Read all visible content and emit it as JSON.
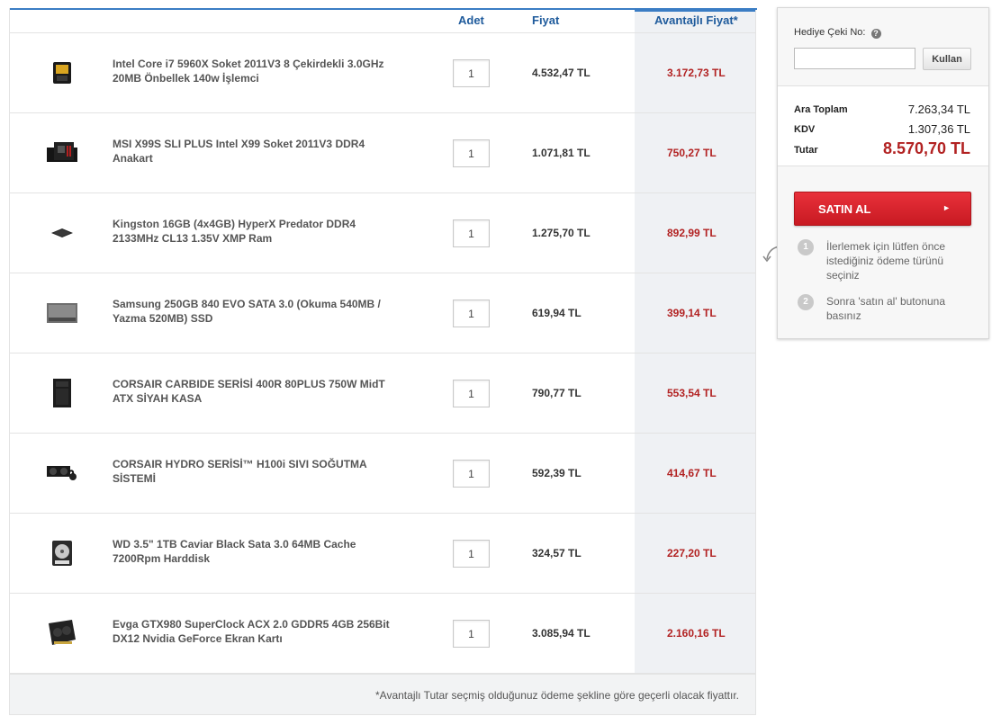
{
  "cart": {
    "headers": {
      "qty": "Adet",
      "price": "Fiyat",
      "advantage": "Avantajlı Fiyat*"
    },
    "items": [
      {
        "name": "Intel Core i7 5960X Soket 2011V3 8 Çekirdekli 3.0GHz 20MB Önbellek 140w İşlemci",
        "qty": "1",
        "price": "4.532,47 TL",
        "adv_price": "3.172,73 TL",
        "icon": "cpu-icon"
      },
      {
        "name": "MSI X99S SLI PLUS Intel X99 Soket 2011V3 DDR4 Anakart",
        "qty": "1",
        "price": "1.071,81 TL",
        "adv_price": "750,27 TL",
        "icon": "motherboard-icon"
      },
      {
        "name": "Kingston 16GB (4x4GB) HyperX Predator DDR4 2133MHz CL13 1.35V XMP Ram",
        "qty": "1",
        "price": "1.275,70 TL",
        "adv_price": "892,99 TL",
        "icon": "ram-icon"
      },
      {
        "name": "Samsung 250GB 840 EVO SATA 3.0 (Okuma 540MB / Yazma 520MB) SSD",
        "qty": "1",
        "price": "619,94 TL",
        "adv_price": "399,14 TL",
        "icon": "ssd-icon"
      },
      {
        "name": "CORSAIR CARBIDE SERİSİ 400R 80PLUS 750W MidT ATX SİYAH KASA",
        "qty": "1",
        "price": "790,77 TL",
        "adv_price": "553,54 TL",
        "icon": "pc-case-icon"
      },
      {
        "name": "CORSAIR HYDRO SERİSİ™ H100i SIVI SOĞUTMA SİSTEMİ",
        "qty": "1",
        "price": "592,39 TL",
        "adv_price": "414,67 TL",
        "icon": "liquid-cooler-icon"
      },
      {
        "name": "WD 3.5\" 1TB Caviar Black Sata 3.0 64MB Cache 7200Rpm Harddisk",
        "qty": "1",
        "price": "324,57 TL",
        "adv_price": "227,20 TL",
        "icon": "hard-disk-icon"
      },
      {
        "name": "Evga GTX980 SuperClock ACX 2.0 GDDR5 4GB 256Bit DX12 Nvidia GeForce Ekran Kartı",
        "qty": "1",
        "price": "3.085,94 TL",
        "adv_price": "2.160,16 TL",
        "icon": "graphics-card-icon"
      }
    ],
    "footnote": "*Avantajlı Tutar seçmiş olduğunuz ödeme şekline göre geçerli olacak fiyattır."
  },
  "summary": {
    "gift_label": "Hediye Çeki No:",
    "gift_value": "",
    "use_label": "Kullan",
    "subtotal_label": "Ara Toplam",
    "subtotal": "7.263,34 TL",
    "tax_label": "KDV",
    "tax": "1.307,36 TL",
    "total_label": "Tutar",
    "total": "8.570,70 TL",
    "buy_label": "SATIN AL",
    "steps": [
      {
        "num": "1",
        "text": "İlerlemek için lütfen önce istediğiniz ödeme türünü seçiniz"
      },
      {
        "num": "2",
        "text": "Sonra 'satın al' butonuna basınız"
      }
    ]
  },
  "colors": {
    "accent_blue": "#3b7dc4",
    "header_blue": "#1f5b9c",
    "price_red": "#b22222",
    "buy_red": "#d9232c"
  }
}
